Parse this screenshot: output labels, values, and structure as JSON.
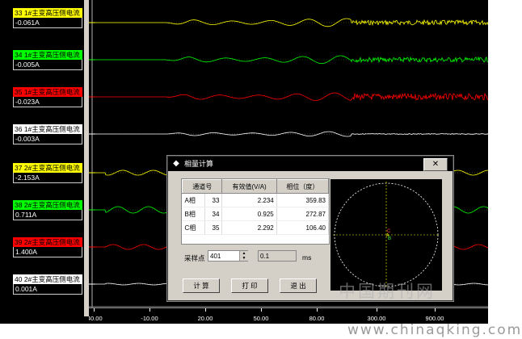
{
  "channels": [
    {
      "name": "33 1#主变高压侧电流",
      "value": "-0.061A",
      "color": "#ffff00"
    },
    {
      "name": "34 1#主变高压侧电流",
      "value": "-0.005A",
      "color": "#00ff00"
    },
    {
      "name": "35 1#主变高压侧电流",
      "value": "-0.023A",
      "color": "#ff0000"
    },
    {
      "name": "36 1#主变高压侧电流",
      "value": "-0.003A",
      "color": "#ffffff"
    },
    {
      "name": "37 2#主变高压侧电流",
      "value": "-2.153A",
      "color": "#ffff00"
    },
    {
      "name": "38 2#主变高压侧电流",
      "value": "0.711A",
      "color": "#00ff00"
    },
    {
      "name": "39 2#主变高压侧电流",
      "value": "1.400A",
      "color": "#ff0000"
    },
    {
      "name": "40 2#主变高压侧电流",
      "value": "0.001A",
      "color": "#ffffff"
    }
  ],
  "time_axis": {
    "ticks": [
      "-40.00",
      "-10.00",
      "20.00",
      "50.00",
      "80.00",
      "300.00",
      "900.00"
    ]
  },
  "dialog": {
    "title": "相量计算",
    "close_label": "✕",
    "headers": [
      "通道号",
      "有效值(V/A)",
      "相位（度）"
    ],
    "rows": [
      {
        "phase": "A相",
        "channel": "33",
        "rms": "2.234",
        "angle": "359.83"
      },
      {
        "phase": "B相",
        "channel": "34",
        "rms": "0.925",
        "angle": "272.87"
      },
      {
        "phase": "C相",
        "channel": "35",
        "rms": "2.292",
        "angle": "106.40"
      }
    ],
    "sample_label": "采样点",
    "sample_value": "401",
    "ms_value": "0.1",
    "ms_unit": "ms",
    "buttons": {
      "calc": "计 算",
      "print": "打 印",
      "exit": "退 出"
    },
    "phasor_labels": {
      "a": "C",
      "b": "B",
      "c": "A"
    }
  },
  "watermark": {
    "cn": "中国期刊网",
    "url": "www.chinaqking.com"
  },
  "colors": {
    "yellow": "#ffff00",
    "green": "#00ff00",
    "red": "#ff0000",
    "white": "#ffffff"
  }
}
